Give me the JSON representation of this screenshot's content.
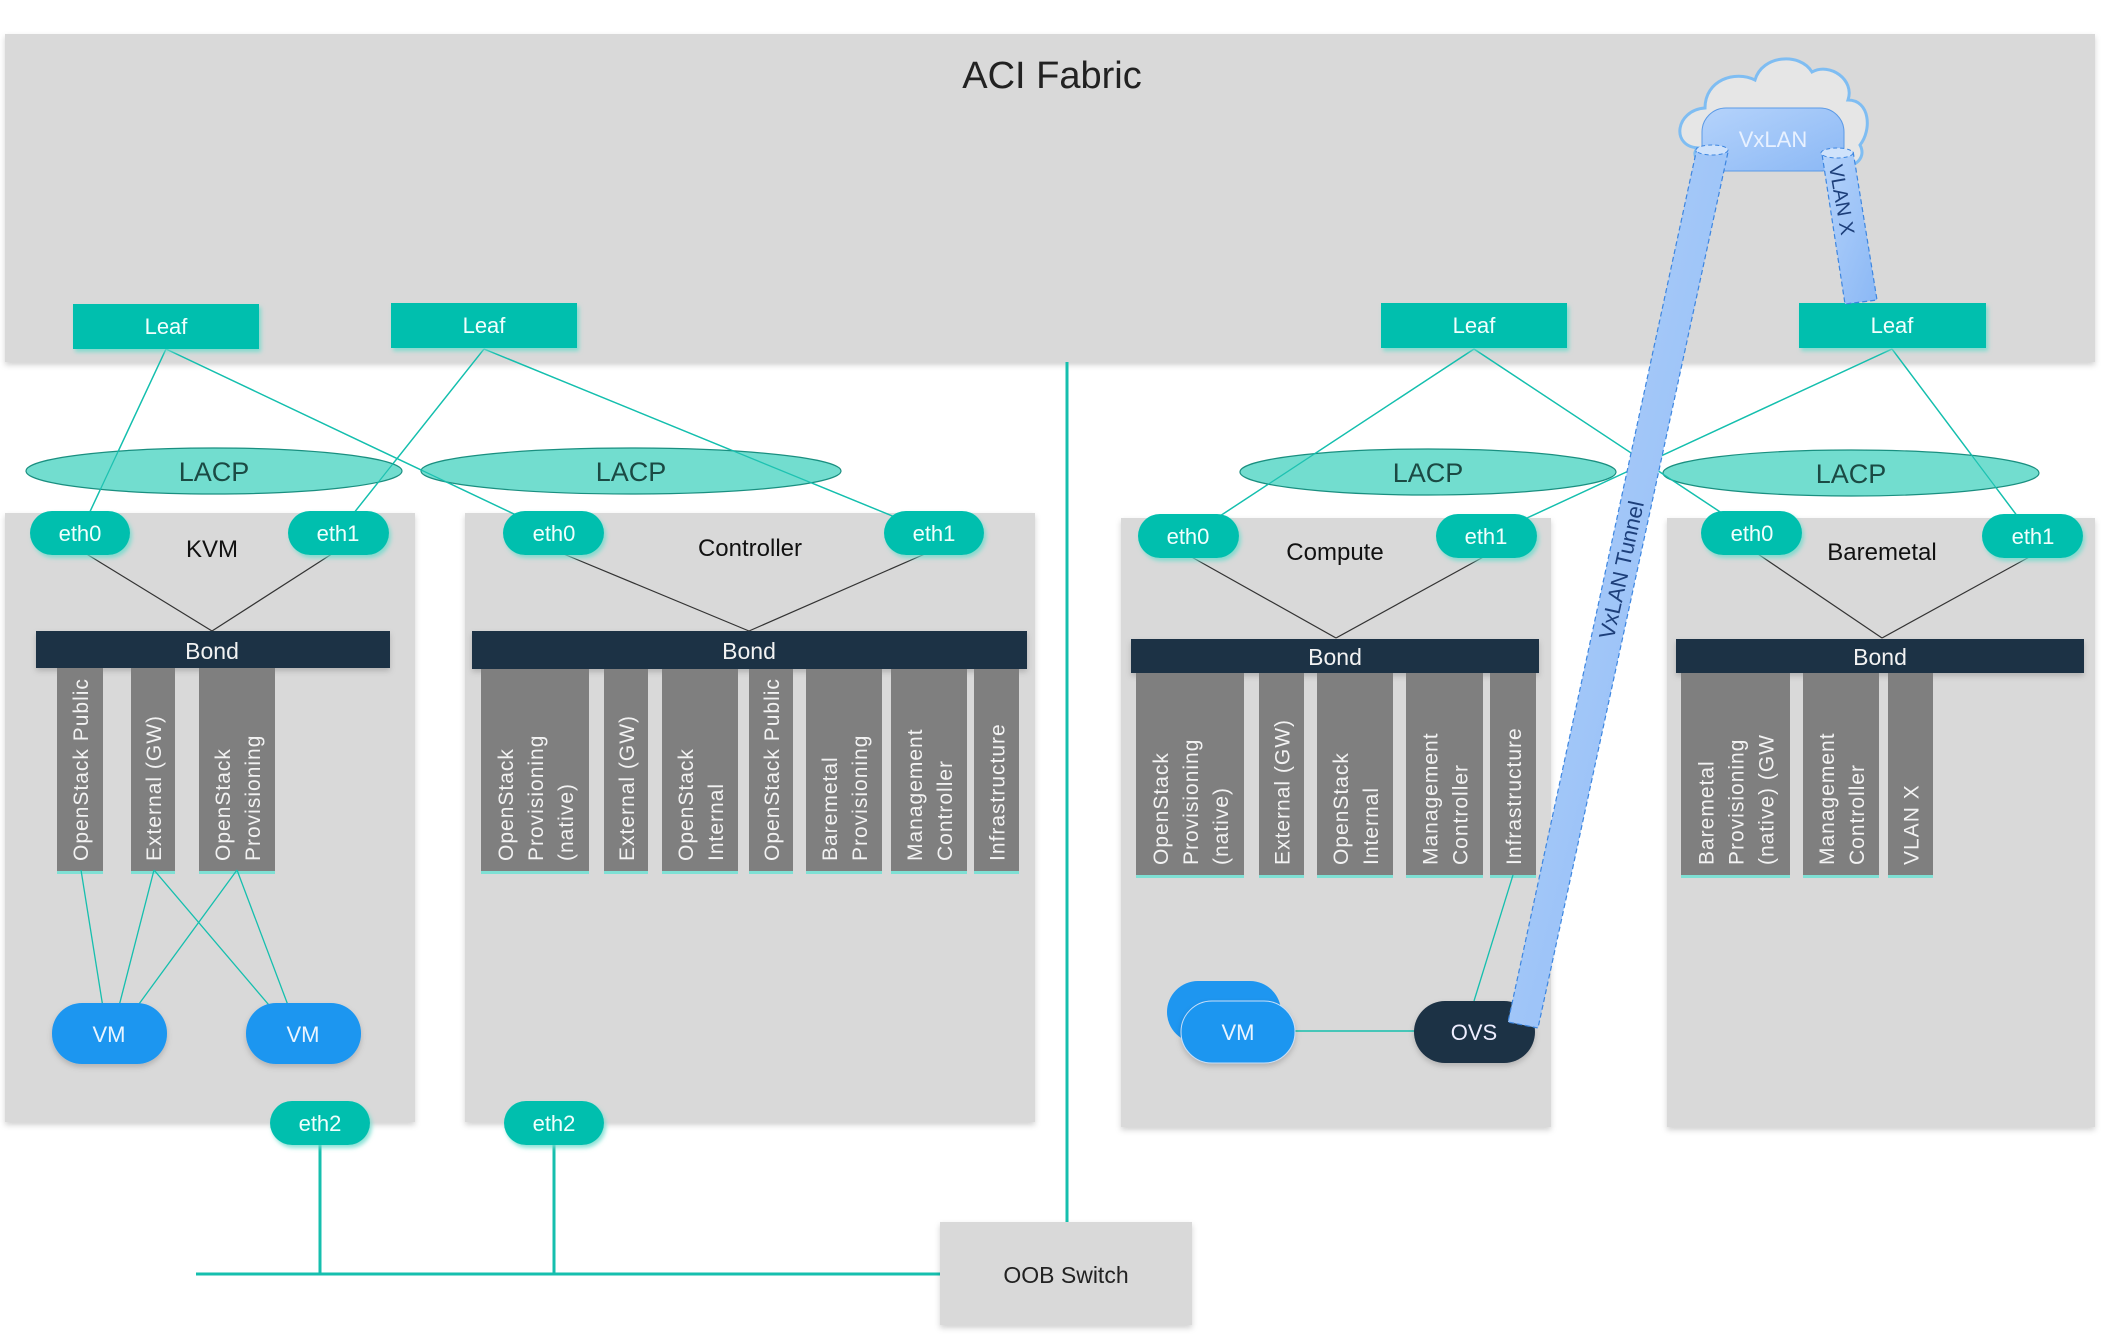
{
  "title": "ACI Fabric",
  "colors": {
    "fabric_bg": "#d9d9d9",
    "leaf": "#00bfae",
    "lacp_fill": "#6adbcc",
    "lacp_stroke": "#1a8f80",
    "bond": "#1f3144",
    "vlan_bar": "#7f7f7f",
    "vm": "#1e96f0",
    "ovs": "#1f3144",
    "tunnel": "#99c2f8",
    "link": "#15bfae"
  },
  "leaves": [
    {
      "label": "Leaf"
    },
    {
      "label": "Leaf"
    },
    {
      "label": "Leaf"
    },
    {
      "label": "Leaf"
    }
  ],
  "lacp": [
    {
      "label": "LACP"
    },
    {
      "label": "LACP"
    },
    {
      "label": "LACP"
    },
    {
      "label": "LACP"
    }
  ],
  "cloud": {
    "label": "VxLAN",
    "vlan_link_label": "VLAN X",
    "tunnel_label": "VxLAN Tunnel"
  },
  "servers": [
    {
      "name": "KVM",
      "eth0": "eth0",
      "eth1": "eth1",
      "eth2": "eth2",
      "bond": "Bond",
      "networks": [
        [
          "OpenStack Public"
        ],
        [
          "External (GW)"
        ],
        [
          "OpenStack",
          "Provisioning"
        ]
      ],
      "vms": [
        "VM",
        "VM"
      ]
    },
    {
      "name": "Controller",
      "eth0": "eth0",
      "eth1": "eth1",
      "eth2": "eth2",
      "bond": "Bond",
      "networks": [
        [
          "OpenStack",
          "Provisioning",
          "(native)"
        ],
        [
          "External (GW)"
        ],
        [
          "OpenStack",
          "Internal"
        ],
        [
          "OpenStack Public"
        ],
        [
          "Baremetal",
          "Provisioning"
        ],
        [
          "Management",
          "Controller"
        ],
        [
          "Infrastructure"
        ]
      ]
    },
    {
      "name": "Compute",
      "eth0": "eth0",
      "eth1": "eth1",
      "bond": "Bond",
      "networks": [
        [
          "OpenStack",
          "Provisioning",
          "(native)"
        ],
        [
          "External (GW)"
        ],
        [
          "OpenStack",
          "Internal"
        ],
        [
          "Management",
          "Controller"
        ],
        [
          "Infrastructure"
        ]
      ],
      "vms": [
        "VM"
      ],
      "ovs": "OVS"
    },
    {
      "name": "Baremetal",
      "eth0": "eth0",
      "eth1": "eth1",
      "bond": "Bond",
      "networks": [
        [
          "Baremetal",
          "Provisioning",
          "(native) (GW"
        ],
        [
          "Management",
          "Controller"
        ],
        [
          "VLAN X"
        ]
      ]
    }
  ],
  "oob_switch": {
    "label": "OOB Switch"
  }
}
